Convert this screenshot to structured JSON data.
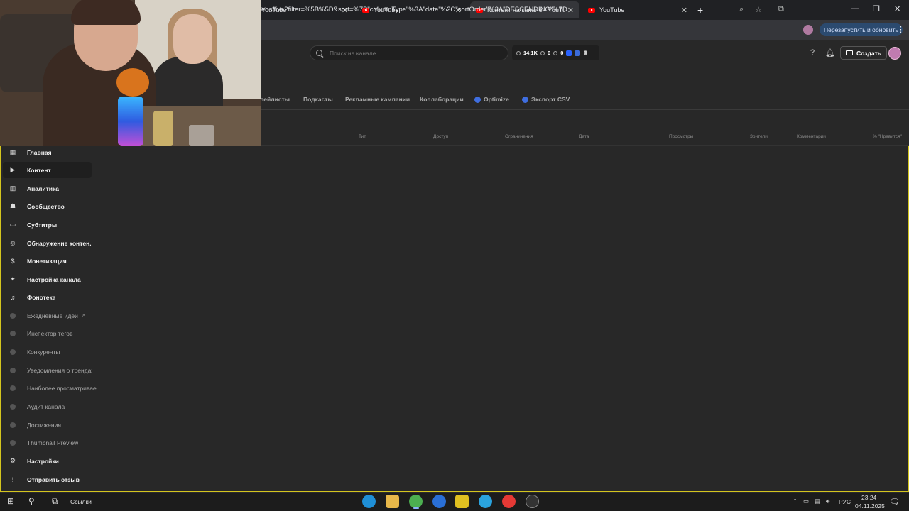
{
  "browser": {
    "tabs": [
      {
        "title": "YouTube",
        "active": false
      },
      {
        "title": "YouTube",
        "active": false
      },
      {
        "title": "Контент на канале - YouTube St",
        "active": true
      },
      {
        "title": "YouTube",
        "active": false
      }
    ],
    "url": "eos/live?filter=%5B%5D&sort=%7B\"columnType\"%3A\"date\"%2C\"sortOrder\"%3A\"DESCENDING\"%7D",
    "restart_label": "Перезапустить и обновить"
  },
  "studio": {
    "search_placeholder": "Поиск на канале",
    "stats": {
      "subscribers": "14.1K",
      "views": "0",
      "comments": "0"
    },
    "create_label": "Создать",
    "content_tabs": [
      "лейлисты",
      "Подкасты",
      "Рекламные кампании",
      "Коллаборации",
      "Optimize",
      "Экспорт CSV"
    ],
    "table_headers": [
      "Тип",
      "Доступ",
      "Ограничения",
      "Дата",
      "Просмотры",
      "Зрители",
      "Комментарии",
      "% \"Нравится\""
    ]
  },
  "sidebar": {
    "items": [
      {
        "label": "Главная",
        "icon": "dashboard-icon",
        "ext": false
      },
      {
        "label": "Контент",
        "icon": "content-icon",
        "ext": false
      },
      {
        "label": "Аналитика",
        "icon": "analytics-icon",
        "ext": false
      },
      {
        "label": "Сообщество",
        "icon": "community-icon",
        "ext": false
      },
      {
        "label": "Субтитры",
        "icon": "subtitles-icon",
        "ext": false
      },
      {
        "label": "Обнаружение контен...",
        "icon": "copyright-icon",
        "ext": false
      },
      {
        "label": "Монетизация",
        "icon": "dollar-icon",
        "ext": false
      },
      {
        "label": "Настройка канала",
        "icon": "wand-icon",
        "ext": false
      },
      {
        "label": "Фонотека",
        "icon": "audio-library-icon",
        "ext": false
      },
      {
        "label": "Ежедневные идеи",
        "icon": "extension-icon",
        "ext": true
      },
      {
        "label": "Инспектор тегов",
        "icon": "extension-icon",
        "ext": true
      },
      {
        "label": "Конкуренты",
        "icon": "extension-icon",
        "ext": true
      },
      {
        "label": "Уведомления о трендах",
        "icon": "extension-icon",
        "ext": true
      },
      {
        "label": "Наиболее просматриваем",
        "icon": "extension-icon",
        "ext": true
      },
      {
        "label": "Аудит канала",
        "icon": "extension-icon",
        "ext": true
      },
      {
        "label": "Достижения",
        "icon": "extension-icon",
        "ext": true
      },
      {
        "label": "Thumbnail Preview",
        "icon": "extension-icon",
        "ext": true
      },
      {
        "label": "Настройки",
        "icon": "gear-icon",
        "ext": false
      },
      {
        "label": "Отправить отзыв",
        "icon": "feedback-icon",
        "ext": false
      }
    ]
  },
  "taskbar": {
    "links_label": "Ссылки",
    "language": "РУС",
    "time": "23:24",
    "date": "04.11.2025",
    "notification_count": "2"
  }
}
